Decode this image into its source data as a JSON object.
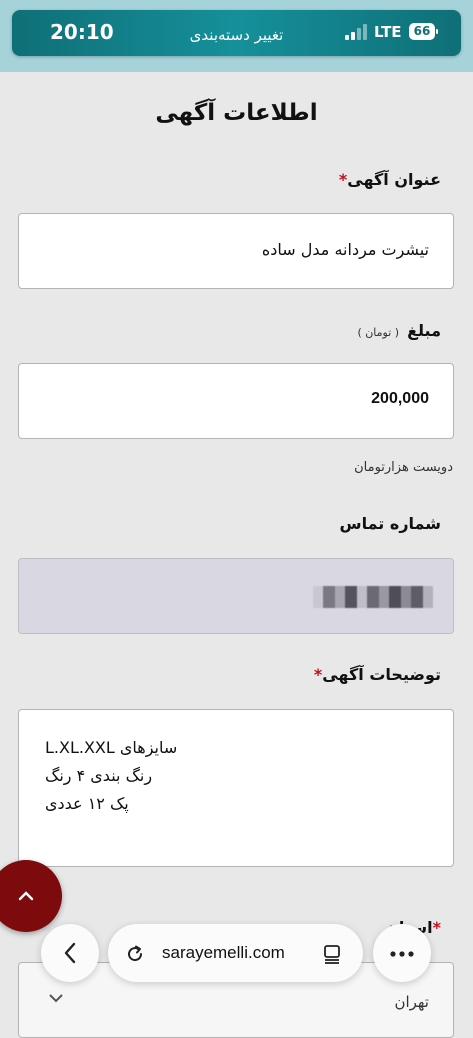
{
  "status_bar": {
    "time": "20:10",
    "title": "تغییر دسته‌بندی",
    "network": "LTE",
    "battery": "66"
  },
  "page": {
    "title": "اطلاعات آگهی"
  },
  "form": {
    "ad_title": {
      "label": "عنوان آگهی",
      "required_mark": "*",
      "value": "تیشرت مردانه مدل ساده"
    },
    "price": {
      "label": "مبلغ",
      "unit": "( تومان )",
      "value": "200,000",
      "helper": "دویست هزارتومان"
    },
    "phone": {
      "label": "شماره تماس"
    },
    "description": {
      "label": "توضیحات آگهی",
      "required_mark": "*",
      "lines": [
        "سایزهای L.XL.XXL",
        "رنگ بندی ۴ رنگ",
        "پک ۱۲ عددی"
      ]
    },
    "province": {
      "label": "استان",
      "required_mark": "*",
      "value": "تهران"
    }
  },
  "browser": {
    "url": "sarayemelli.com"
  },
  "colors": {
    "accent": "#7d0b0e",
    "status_bar": "#0f6f77",
    "required": "#c0101b"
  }
}
